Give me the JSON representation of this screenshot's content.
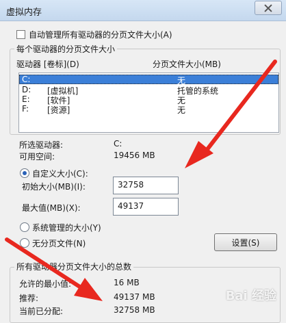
{
  "window": {
    "title": "虚拟内存"
  },
  "auto_manage": {
    "label": "自动管理所有驱动器的分页文件大小(A)",
    "checked": false
  },
  "per_drive_group": {
    "legend": "每个驱动器的分页文件大小",
    "col_drive": "驱动器 [卷标](D)",
    "col_size": "分页文件大小(MB)",
    "rows": [
      {
        "drive": "C:",
        "label": "",
        "size": "无",
        "selected": true
      },
      {
        "drive": "D:",
        "label": "[虚拟机]",
        "size": "托管的系统"
      },
      {
        "drive": "E:",
        "label": "[软件]",
        "size": "无"
      },
      {
        "drive": "F:",
        "label": "[资源]",
        "size": "无"
      }
    ]
  },
  "selected_drive": {
    "label": "所选驱动器:",
    "value": "C:"
  },
  "free_space": {
    "label": "可用空间:",
    "value": "19456 MB"
  },
  "custom_size": {
    "label": "自定义大小(C):",
    "selected": true,
    "initial_label": "初始大小(MB)(I):",
    "initial_value": "32758",
    "max_label": "最大值(MB)(X):",
    "max_value": "49137"
  },
  "system_managed": {
    "label": "系统管理的大小(Y)",
    "selected": false
  },
  "no_paging": {
    "label": "无分页文件(N)",
    "selected": false
  },
  "set_button": {
    "label": "设置(S)"
  },
  "totals_group": {
    "legend": "所有驱动器分页文件大小的总数",
    "min_label": "允许的最小值:",
    "min_value": "16 MB",
    "recommended_label": "推荐:",
    "recommended_value": "49137 MB",
    "current_label": "当前已分配:",
    "current_value": "32758 MB"
  },
  "watermark": {
    "text": "Bai 经验"
  },
  "colors": {
    "selection": "#3b7fd8",
    "arrow": "#e8281f",
    "titlebar": "#c4d8ee"
  }
}
